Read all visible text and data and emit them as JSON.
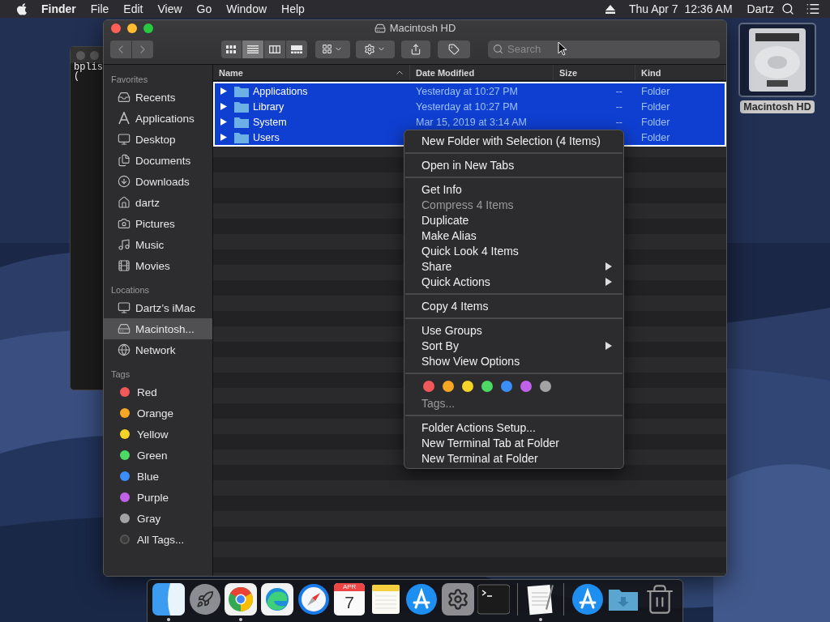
{
  "menubar": {
    "app_name": "Finder",
    "menus": [
      "File",
      "Edit",
      "View",
      "Go",
      "Window",
      "Help"
    ],
    "clock": "Thu Apr 7  12:36 AM",
    "user": "Dartz"
  },
  "terminal": {
    "lines": [
      "bplis",
      "("
    ]
  },
  "window": {
    "title": "Macintosh HD",
    "toolbar": {
      "view_modes": [
        {
          "kind": "icons",
          "selected": false
        },
        {
          "kind": "list",
          "selected": true
        },
        {
          "kind": "columns",
          "selected": false
        },
        {
          "kind": "gallery",
          "selected": false
        }
      ],
      "search": {
        "placeholder": "Search"
      }
    },
    "sidebar": [
      {
        "title": "Favorites",
        "items": [
          {
            "label": "Recents",
            "kind": "recents",
            "selected": false
          },
          {
            "label": "Applications",
            "kind": "applications",
            "selected": false
          },
          {
            "label": "Desktop",
            "kind": "desktop",
            "selected": false
          },
          {
            "label": "Documents",
            "kind": "documents",
            "selected": false
          },
          {
            "label": "Downloads",
            "kind": "downloads",
            "selected": false
          },
          {
            "label": "dartz",
            "kind": "home",
            "selected": false
          },
          {
            "label": "Pictures",
            "kind": "pictures",
            "selected": false
          },
          {
            "label": "Music",
            "kind": "music",
            "selected": false
          },
          {
            "label": "Movies",
            "kind": "movies",
            "selected": false
          }
        ]
      },
      {
        "title": "Locations",
        "items": [
          {
            "label": "Dartz’s iMac",
            "kind": "computer",
            "selected": false
          },
          {
            "label": "Macintosh...",
            "kind": "disk",
            "selected": true
          },
          {
            "label": "Network",
            "kind": "network",
            "selected": false
          }
        ]
      },
      {
        "title": "Tags",
        "items": [
          {
            "label": "Red",
            "kind": "tag",
            "color": "#f0585a",
            "selected": false
          },
          {
            "label": "Orange",
            "kind": "tag",
            "color": "#f5a623",
            "selected": false
          },
          {
            "label": "Yellow",
            "kind": "tag",
            "color": "#f5d328",
            "selected": false
          },
          {
            "label": "Green",
            "kind": "tag",
            "color": "#4cd964",
            "selected": false
          },
          {
            "label": "Blue",
            "kind": "tag",
            "color": "#3a8ef6",
            "selected": false
          },
          {
            "label": "Purple",
            "kind": "tag",
            "color": "#c160e8",
            "selected": false
          },
          {
            "label": "Gray",
            "kind": "tag",
            "color": "#a3a3a6",
            "selected": false
          },
          {
            "label": "All Tags...",
            "kind": "all-tags",
            "selected": false
          }
        ]
      }
    ],
    "table": {
      "columns": [
        {
          "label": "Name",
          "sorted": true
        },
        {
          "label": "Date Modified",
          "sorted": false
        },
        {
          "label": "Size",
          "sorted": false
        },
        {
          "label": "Kind",
          "sorted": false
        }
      ],
      "rows": [
        {
          "name": "Applications",
          "date": "Yesterday at 10:27 PM",
          "size": "--",
          "kind": "Folder",
          "selected": true
        },
        {
          "name": "Library",
          "date": "Yesterday at 10:27 PM",
          "size": "--",
          "kind": "Folder",
          "selected": true
        },
        {
          "name": "System",
          "date": "Mar 15, 2019 at 3:14 AM",
          "size": "--",
          "kind": "Folder",
          "selected": true
        },
        {
          "name": "Users",
          "kind": "Folder",
          "selected": true
        }
      ]
    }
  },
  "context_menu": [
    {
      "kind": "items",
      "items": [
        {
          "label": "New Folder with Selection (4 Items)",
          "disabled": false,
          "submenu": false
        }
      ]
    },
    {
      "kind": "items",
      "items": [
        {
          "label": "Open in New Tabs",
          "disabled": false,
          "submenu": false
        }
      ]
    },
    {
      "kind": "items",
      "items": [
        {
          "label": "Get Info",
          "disabled": false,
          "submenu": false
        },
        {
          "label": "Compress 4 Items",
          "disabled": true,
          "submenu": false
        },
        {
          "label": "Duplicate",
          "disabled": false,
          "submenu": false
        },
        {
          "label": "Make Alias",
          "disabled": false,
          "submenu": false
        },
        {
          "label": "Quick Look 4 Items",
          "disabled": false,
          "submenu": false
        },
        {
          "label": "Share",
          "disabled": false,
          "submenu": true
        },
        {
          "label": "Quick Actions",
          "disabled": false,
          "submenu": true
        }
      ]
    },
    {
      "kind": "items",
      "items": [
        {
          "label": "Copy 4 Items",
          "disabled": false,
          "submenu": false
        }
      ]
    },
    {
      "kind": "items",
      "items": [
        {
          "label": "Use Groups",
          "disabled": false,
          "submenu": false
        },
        {
          "label": "Sort By",
          "disabled": false,
          "submenu": true
        },
        {
          "label": "Show View Options",
          "disabled": false,
          "submenu": false
        }
      ]
    },
    {
      "kind": "tags",
      "colors": [
        {
          "color": "#f0585a"
        },
        {
          "color": "#f5a623"
        },
        {
          "color": "#f5d328"
        },
        {
          "color": "#4cd964"
        },
        {
          "color": "#3a8ef6"
        },
        {
          "color": "#c160e8"
        },
        {
          "color": "#a3a3a6"
        }
      ],
      "label": "Tags..."
    },
    {
      "kind": "items",
      "items": [
        {
          "label": "Folder Actions Setup...",
          "disabled": false,
          "submenu": false
        },
        {
          "label": "New Terminal Tab at Folder",
          "disabled": false,
          "submenu": false
        },
        {
          "label": "New Terminal at Folder",
          "disabled": false,
          "submenu": false
        }
      ]
    }
  ],
  "desktop_icons": [
    {
      "label": "Macintosh HD",
      "selected": true
    }
  ],
  "dock": [
    {
      "kind": "finder",
      "running": true
    },
    {
      "kind": "launchpad",
      "running": false
    },
    {
      "kind": "chrome",
      "running": true
    },
    {
      "kind": "edge",
      "running": false
    },
    {
      "kind": "safari",
      "running": false
    },
    {
      "kind": "calendar",
      "month": "APR",
      "day": "7",
      "running": false
    },
    {
      "kind": "notes",
      "running": false
    },
    {
      "kind": "appstore",
      "running": false
    },
    {
      "kind": "preferences",
      "running": false
    },
    {
      "kind": "terminal",
      "running": false
    },
    {
      "kind": "separator"
    },
    {
      "kind": "textedit",
      "running": true
    },
    {
      "kind": "separator"
    },
    {
      "kind": "appstore",
      "running": false
    },
    {
      "kind": "downloads",
      "running": false
    },
    {
      "kind": "trash",
      "running": false
    }
  ]
}
